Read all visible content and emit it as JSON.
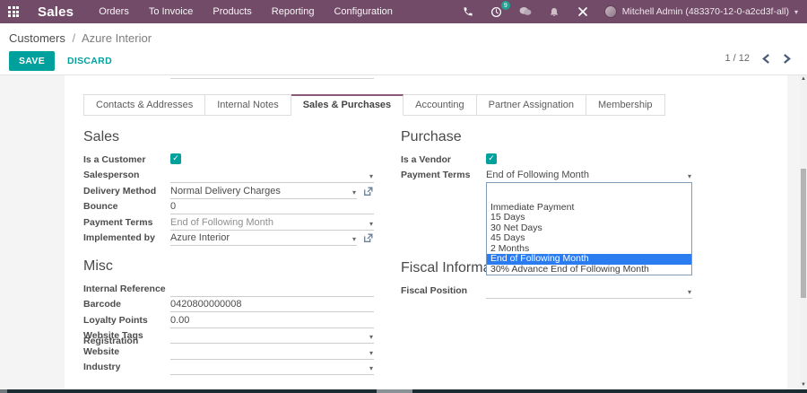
{
  "colors": {
    "topbar": "#714B67",
    "accent": "#00A09D",
    "dropdown_highlight": "#2b7cf0"
  },
  "topbar": {
    "app_name": "Sales",
    "menus": [
      "Orders",
      "To Invoice",
      "Products",
      "Reporting",
      "Configuration"
    ],
    "activity_count": "9",
    "user_name": "Mitchell Admin (483370-12-0-a2cd3f-all)"
  },
  "control_panel": {
    "breadcrumb_parent": "Customers",
    "breadcrumb_separator": "/",
    "breadcrumb_current": "Azure Interior",
    "save": "SAVE",
    "discard": "DISCARD",
    "pager": "1 / 12"
  },
  "tabs": {
    "items": [
      "Contacts & Addresses",
      "Internal Notes",
      "Sales & Purchases",
      "Accounting",
      "Partner Assignation",
      "Membership"
    ],
    "active": "Sales & Purchases"
  },
  "sales": {
    "heading": "Sales",
    "is_customer_label": "Is a Customer",
    "salesperson_label": "Salesperson",
    "salesperson_value": "",
    "delivery_label": "Delivery Method",
    "delivery_value": "Normal Delivery Charges",
    "bounce_label": "Bounce",
    "bounce_value": "0",
    "payment_terms_label": "Payment Terms",
    "payment_terms_value": "End of Following Month",
    "implemented_label": "Implemented by",
    "implemented_value": "Azure Interior"
  },
  "purchase": {
    "heading": "Purchase",
    "is_vendor_label": "Is a Vendor",
    "payment_terms_label": "Payment Terms",
    "payment_terms_value": "End of Following Month"
  },
  "payment_dropdown": {
    "items": [
      "",
      "Immediate Payment",
      "15 Days",
      "30 Net Days",
      "45 Days",
      "2 Months",
      "End of Following Month",
      "30% Advance End of Following Month"
    ],
    "selected": "End of Following Month"
  },
  "misc": {
    "heading": "Misc",
    "internal_ref_label": "Internal Reference",
    "internal_ref_value": "",
    "barcode_label": "Barcode",
    "barcode_value": "0420800000008",
    "loyalty_label": "Loyalty Points",
    "loyalty_value": "0.00",
    "website_tags_label": "Website Tags",
    "website_tags_value": "",
    "registration_label": "Registration Website",
    "registration_value": "",
    "industry_label": "Industry",
    "industry_value": ""
  },
  "fiscal": {
    "heading": "Fiscal Information",
    "fiscal_position_label": "Fiscal Position",
    "fiscal_position_value": ""
  },
  "icons": {
    "caret": "▾",
    "check": "✓",
    "scroll_up": "▲",
    "scroll_down": "▼"
  }
}
